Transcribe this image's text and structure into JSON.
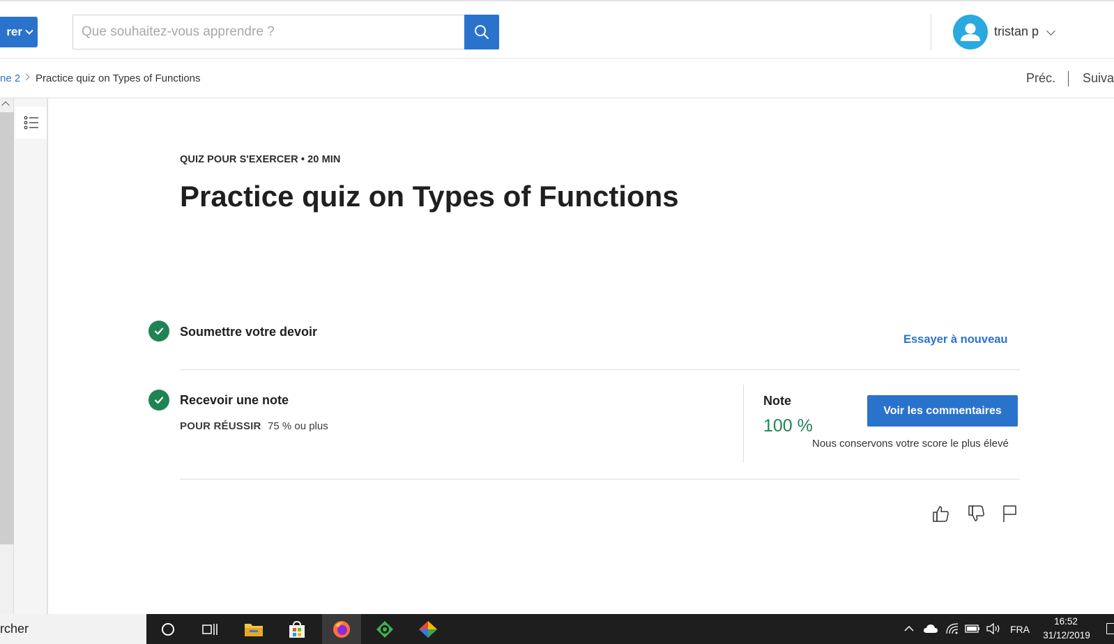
{
  "header": {
    "explore_label": "rer",
    "search_placeholder": "Que souhaitez-vous apprendre ?",
    "username": "tristan p"
  },
  "breadcrumb": {
    "previous": "ne 2",
    "current": "Practice quiz on Types of Functions",
    "nav_prev": "Préc.",
    "nav_next": "Suivar"
  },
  "quiz": {
    "meta": "QUIZ POUR S'EXERCER • 20  MIN",
    "title": "Practice quiz on Types of Functions",
    "submit_step": "Soumettre votre devoir",
    "retry_link": "Essayer à nouveau",
    "grade_step": "Recevoir une note",
    "pass_label": "POUR RÉUSSIR",
    "pass_value": "75 % ou plus",
    "grade_label": "Note",
    "grade_value": "100 %",
    "feedback_button": "Voir les commentaires",
    "keep_note": "Nous conservons votre score le plus élevé"
  },
  "taskbar": {
    "search_text": "rcher",
    "language": "FRA",
    "time": "16:52",
    "date": "31/12/2019"
  },
  "colors": {
    "accent": "#2a73cc",
    "success": "#1f8354",
    "taskbar": "#1e1e1e"
  },
  "icons": [
    "search-icon",
    "user-avatar-icon",
    "chevron-down-icon",
    "list-icon",
    "check-circle-icon",
    "thumbs-up-icon",
    "thumbs-down-icon",
    "flag-icon"
  ]
}
